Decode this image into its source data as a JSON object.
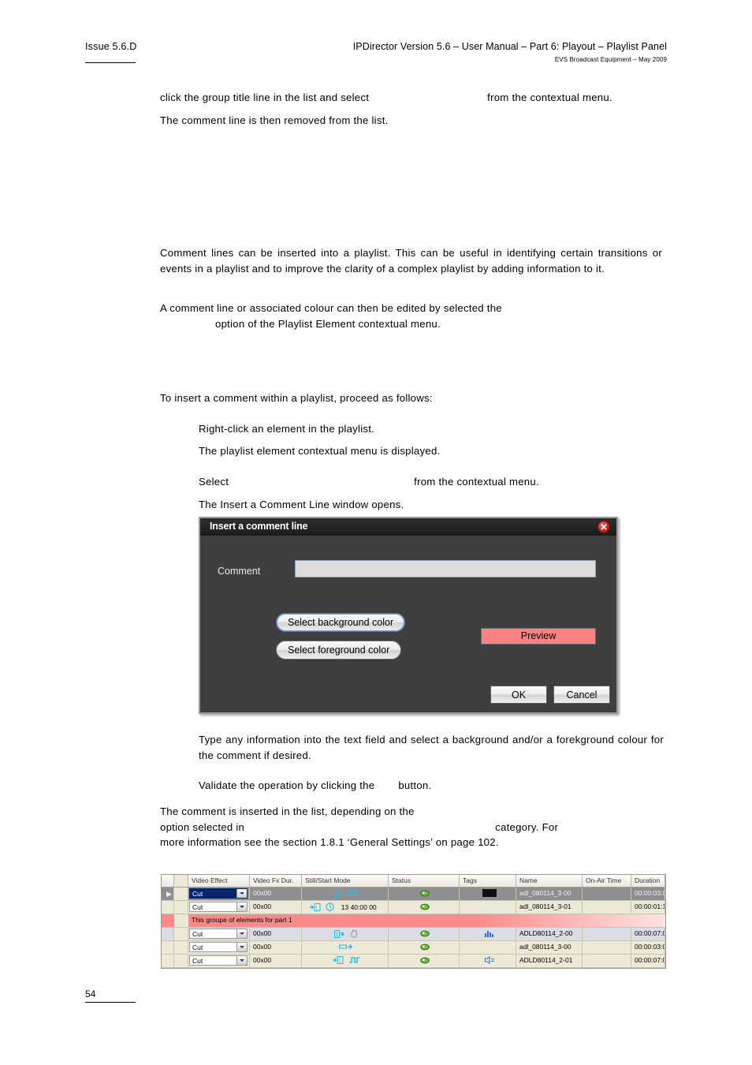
{
  "header": {
    "issue": "Issue 5.6.D",
    "title": "IPDirector Version 5.6 – User Manual – Part 6: Playout – Playlist Panel",
    "subtitle": "EVS Broadcast Equipment – May 2009"
  },
  "body": {
    "intro_line1_a": "click the group title line in the list and select",
    "intro_line1_b": "from the contextual menu.",
    "intro_line2": "The comment line is then removed from the list.",
    "description": "Comment lines can be inserted into a playlist. This can be useful in identifying certain transitions or events in a playlist and to improve the clarity of a complex playlist by adding information to it.",
    "edit_line_a": "A comment line or associated colour can then be edited by selected the",
    "edit_line_b": "option of the Playlist Element contextual menu.",
    "procedure_intro": "To insert a comment within a playlist, proceed as follows:",
    "step_right_click": "Right-click an element in the playlist.",
    "step_menu_displayed": "The playlist element contextual menu is displayed.",
    "step_select_a": "Select",
    "step_select_b": "from the contextual menu.",
    "step_window_opens": "The Insert a Comment Line window opens.",
    "step_type_info": "Type any information into the text field and select a background and/or a forekground colour for the comment if desired.",
    "step_validate_a": "Validate the operation by clicking the",
    "step_validate_b": "button.",
    "final_a": "The comment is inserted in the list, depending on the",
    "final_b": "option selected in",
    "final_c": "category. For",
    "final_d": "more information see the section 1.8.1 ‘General Settings’ on page 102."
  },
  "dialog": {
    "title": "Insert a comment line",
    "close_icon": "close-icon",
    "comment_label": "Comment",
    "comment_value": "",
    "comment_placeholder": "",
    "select_background_label": "Select background color",
    "select_foreground_label": "Select foreground color",
    "preview_label": "Preview",
    "preview_color": "#fa8282",
    "ok_label": "OK",
    "cancel_label": "Cancel"
  },
  "grid": {
    "columns": [
      "Video Effect",
      "Video Fx Dur.",
      "Still/Start Mode",
      "Status",
      "Tags",
      "Name",
      "On-Air Time",
      "Duration"
    ],
    "rows": [
      {
        "marker": "▶",
        "effect": "Cut",
        "fx_dur": "00x00",
        "still_mode": "",
        "status": "",
        "tags": "",
        "name": "adl_080114_3-00",
        "on_air": "",
        "duration": "00:00:03:0",
        "selected": true
      },
      {
        "marker": "",
        "effect": "Cut",
        "fx_dur": "00x00",
        "still_mode": "13 40:00 00",
        "status": "",
        "tags": "",
        "name": "adl_080114_3-01",
        "on_air": "",
        "duration": "00:00:01:1",
        "selected": false
      },
      {
        "marker": "",
        "effect": "Cut",
        "fx_dur": "00x00",
        "still_mode": "",
        "status": "",
        "tags": "",
        "name": "ADLD80114_2-00",
        "on_air": "",
        "duration": "00:00:07:0",
        "selected": false,
        "alt": true
      },
      {
        "marker": "",
        "effect": "Cut",
        "fx_dur": "00x00",
        "still_mode": "",
        "status": "",
        "tags": "",
        "name": "adl_080114_3-00",
        "on_air": "",
        "duration": "00:00:03:0",
        "selected": false
      },
      {
        "marker": "",
        "effect": "Cut",
        "fx_dur": "00x00",
        "still_mode": "",
        "status": "",
        "tags": "",
        "name": "ADLD80114_2-01",
        "on_air": "",
        "duration": "00:00:07:0",
        "selected": false
      }
    ],
    "comment_row": {
      "text": "This groupe of elements for part 1",
      "background_color": "#fb8a8a"
    }
  },
  "footer": {
    "page_number": "54"
  }
}
